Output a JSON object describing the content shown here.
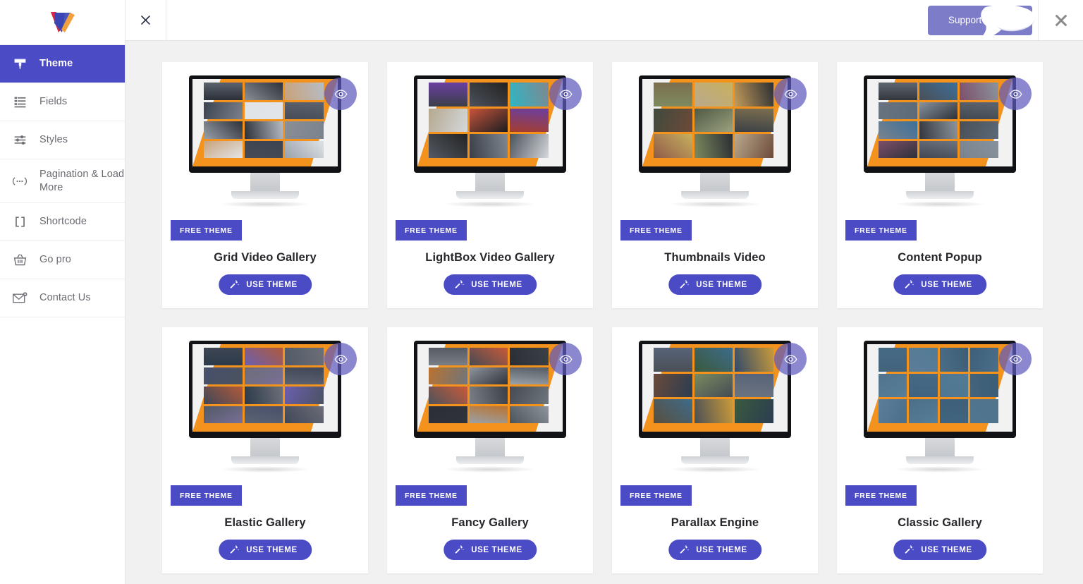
{
  "app": {
    "logo_name": "vertical-logo",
    "accent_color": "#4b4bc6",
    "support_button_color": "#7c7cc9",
    "background_color": "#f1f1f1",
    "badge_color": "#4b4bc6"
  },
  "sidebar": {
    "items": [
      {
        "label": "Theme",
        "icon": "paint-brush-icon",
        "active": true
      },
      {
        "label": "Fields",
        "icon": "list-fields-icon",
        "active": false
      },
      {
        "label": "Styles",
        "icon": "sliders-icon",
        "active": false
      },
      {
        "label": "Pagination & Load More",
        "icon": "ellipsis-icon",
        "active": false
      },
      {
        "label": "Shortcode",
        "icon": "brackets-icon",
        "active": false
      },
      {
        "label": "Go pro",
        "icon": "basket-icon",
        "active": false
      },
      {
        "label": "Contact Us",
        "icon": "envelope-icon",
        "active": false
      }
    ]
  },
  "topbar": {
    "panel_close_icon": "close-x-icon",
    "support_label": "Support Forum",
    "support_icon": "chat-bubble-icon",
    "modal_close_icon": "close-x-icon"
  },
  "themes": {
    "free_badge_label": "FREE THEME",
    "use_theme_label": "USE THEME",
    "use_theme_icon": "magic-wand-icon",
    "preview_icon": "eye-icon",
    "cards": [
      {
        "title": "Grid Video Gallery",
        "badge": "FREE THEME",
        "action": "USE THEME",
        "layout": "grid-3x4"
      },
      {
        "title": "LightBox Video Gallery",
        "badge": "FREE THEME",
        "action": "USE THEME",
        "layout": "grid-3x3"
      },
      {
        "title": "Thumbnails Video",
        "badge": "FREE THEME",
        "action": "USE THEME",
        "layout": "grid-3x3"
      },
      {
        "title": "Content Popup",
        "badge": "FREE THEME",
        "action": "USE THEME",
        "layout": "grid-3x4"
      },
      {
        "title": "Elastic Gallery",
        "badge": "FREE THEME",
        "action": "USE THEME",
        "layout": "grid-3x4"
      },
      {
        "title": "Fancy Gallery",
        "badge": "FREE THEME",
        "action": "USE THEME",
        "layout": "grid-3x4"
      },
      {
        "title": "Parallax Engine",
        "badge": "FREE THEME",
        "action": "USE THEME",
        "layout": "grid-3x3"
      },
      {
        "title": "Classic Gallery",
        "badge": "FREE THEME",
        "action": "USE THEME",
        "layout": "grid-4x3"
      }
    ]
  }
}
